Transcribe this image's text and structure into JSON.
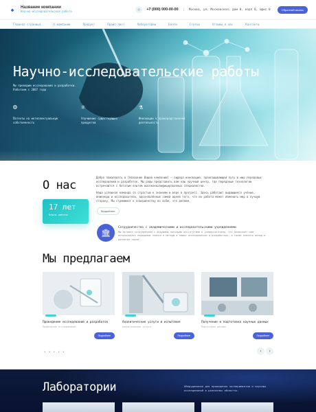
{
  "header": {
    "company_name": "Название компании",
    "company_tagline": "Научно-исследовательская работа",
    "phone": "+7 (000) 000-00-00",
    "separator": "|",
    "address": "Москва, ул. Московская, дом 0, корп 0, офис 0",
    "cta_label": "Обратный звонок",
    "phone_icon": "phone-icon"
  },
  "nav": {
    "items": [
      "Главная страница",
      "О компании",
      "Продукт",
      "Прайс-лист",
      "Лаборатории",
      "Блоги",
      "Статьи",
      "Отзывы о нас",
      "Контакты"
    ]
  },
  "hero": {
    "title": "Научно-исследовательские работы",
    "description": "Мы проводим исследования и разработки. Работаем с 2007 года",
    "features": [
      {
        "icon": "patent-icon",
        "label": "Патенты на интеллектуальную собственность"
      },
      {
        "icon": "product-icon",
        "label": "Улучшение существующих продуктов"
      },
      {
        "icon": "research-icon",
        "label": "Инновации в производственной деятельности"
      }
    ]
  },
  "about": {
    "title": "О нас",
    "years_value": "17 лет",
    "years_label": "Опыта работы",
    "paragraph1": "Добро пожаловать в [Название Вашей компании] – лидера инноваций, прокладывающей путь в мир передовых исследований и разработок. Мы рады представить вам наш научный центр, где передовые технологии встречаются с богатым опытом высококвалифицированных специалистов.",
    "paragraph2": "Наша успешная команда со страстью к знаниям и вере в прогресс. Здесь работают выдающиеся учёные, инженеры и исследователи, вдохновлённые самой идеей того, что их работа может изменить мир в лучшую сторону. Мы стремимся к совершенству во всём, что делаем.",
    "more_label": "Подробнее",
    "collab_title": "Сотрудничество с академическими и исследовательскими учреждениями",
    "collab_text": "Мы активно сотрудничаем с ведущими научными институтами и университетами, что позволяет нам использовать передовые знания и методы в наших исследованиях и разработках, а также вносить вклад в развитие науки.",
    "collab_icon": "institution-icon"
  },
  "offer": {
    "title": "Мы предлагаем",
    "cards": [
      {
        "title": "Проведение исследований и разработок",
        "subtitle": "Проведение исследований",
        "button": "Подробнее"
      },
      {
        "title": "Аналитические услуги и испытания",
        "subtitle": "Аналитические услуги",
        "button": "Подробнее"
      },
      {
        "title": "Получение и подготовка научных данных",
        "subtitle": "Подготовка данных",
        "button": "Подробнее"
      }
    ],
    "pager": "• • • • •",
    "prev_icon": "chevron-left-icon",
    "next_icon": "chevron-right-icon"
  },
  "labs": {
    "title": "Лаборатории",
    "description": "Оборудование для проведения экспериментов и научных исследований в различных областях."
  }
}
